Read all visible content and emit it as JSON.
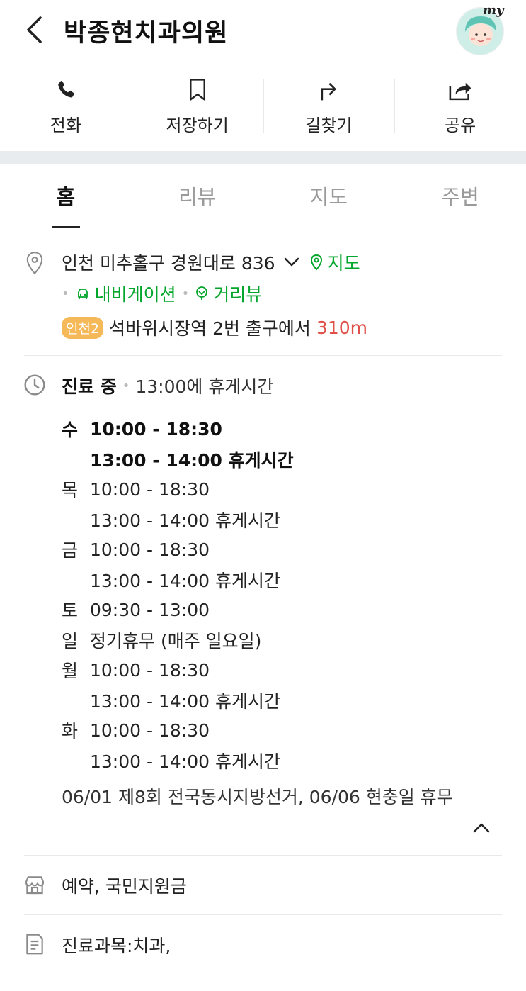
{
  "header": {
    "title": "박종현치과의원",
    "avatar_badge": "my"
  },
  "actions": [
    {
      "label": "전화",
      "icon": "phone-icon"
    },
    {
      "label": "저장하기",
      "icon": "bookmark-icon"
    },
    {
      "label": "길찾기",
      "icon": "directions-icon"
    },
    {
      "label": "공유",
      "icon": "share-icon"
    }
  ],
  "tabs": [
    {
      "label": "홈",
      "active": true
    },
    {
      "label": "리뷰",
      "active": false
    },
    {
      "label": "지도",
      "active": false
    },
    {
      "label": "주변",
      "active": false
    }
  ],
  "address": {
    "text": "인천 미추홀구 경원대로 836",
    "map_link": "지도",
    "navigation_link": "내비게이션",
    "streetview_link": "거리뷰",
    "subway_line": "인천2",
    "subway_station": "석바위시장역",
    "exit_text": "2번 출구에서",
    "distance": "310m"
  },
  "hours": {
    "status": "진료 중",
    "note": "13:00에 휴게시간",
    "schedule": [
      {
        "day": "수",
        "time": "10:00 - 18:30",
        "bold": true
      },
      {
        "day": "",
        "time": "13:00 - 14:00 휴게시간",
        "bold": true
      },
      {
        "day": "목",
        "time": "10:00 - 18:30",
        "bold": false
      },
      {
        "day": "",
        "time": "13:00 - 14:00 휴게시간",
        "bold": false
      },
      {
        "day": "금",
        "time": "10:00 - 18:30",
        "bold": false
      },
      {
        "day": "",
        "time": "13:00 - 14:00 휴게시간",
        "bold": false
      },
      {
        "day": "토",
        "time": "09:30 - 13:00",
        "bold": false
      },
      {
        "day": "일",
        "time": "정기휴무 (매주 일요일)",
        "bold": false
      },
      {
        "day": "월",
        "time": "10:00 - 18:30",
        "bold": false
      },
      {
        "day": "",
        "time": "13:00 - 14:00 휴게시간",
        "bold": false
      },
      {
        "day": "화",
        "time": "10:00 - 18:30",
        "bold": false
      },
      {
        "day": "",
        "time": "13:00 - 14:00 휴게시간",
        "bold": false
      }
    ],
    "holiday_notice": "06/01 제8회 전국동시지방선거, 06/06 현충일 휴무"
  },
  "services": "예약, 국민지원금",
  "department": "진료과목:치과,",
  "colors": {
    "green": "#03a62c",
    "distance_red": "#e0504a",
    "subway_badge": "#f5b95a"
  }
}
